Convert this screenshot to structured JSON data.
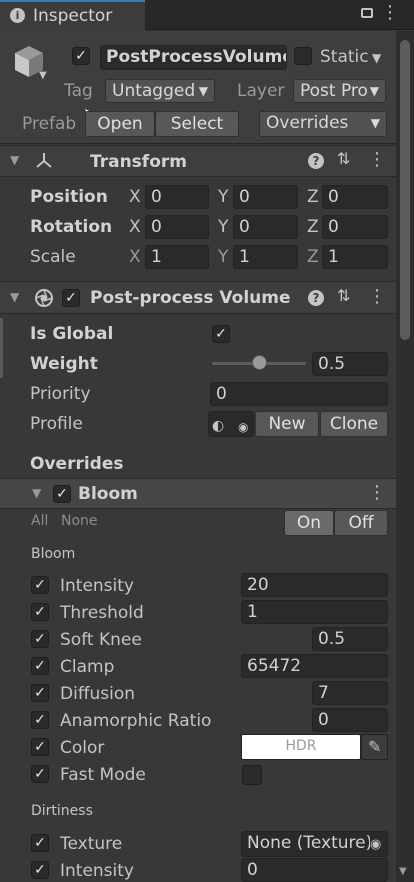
{
  "tab": {
    "title": "Inspector"
  },
  "header": {
    "name": "PostProcessVolume",
    "static_label": "Static",
    "tag_label": "Tag",
    "tag_value": "Untagged",
    "layer_label": "Layer",
    "layer_value": "Post Pro",
    "prefab_label": "Prefab",
    "open_label": "Open",
    "select_label": "Select",
    "overrides_label": "Overrides"
  },
  "transform": {
    "title": "Transform",
    "position": {
      "label": "Position",
      "x": "0",
      "y": "0",
      "z": "0"
    },
    "rotation": {
      "label": "Rotation",
      "x": "0",
      "y": "0",
      "z": "0"
    },
    "scale": {
      "label": "Scale",
      "x": "1",
      "y": "1",
      "z": "1"
    },
    "axis_x": "X",
    "axis_y": "Y",
    "axis_z": "Z"
  },
  "volume": {
    "title": "Post-process Volume",
    "is_global_label": "Is Global",
    "weight_label": "Weight",
    "weight_value": "0.5",
    "weight_fraction": 0.5,
    "priority_label": "Priority",
    "priority_value": "0",
    "profile_label": "Profile",
    "new_label": "New",
    "clone_label": "Clone",
    "overrides_title": "Overrides"
  },
  "bloom": {
    "title": "Bloom",
    "all_label": "All",
    "none_label": "None",
    "on_label": "On",
    "off_label": "Off",
    "section_label": "Bloom",
    "params": [
      {
        "label": "Intensity",
        "value": "20"
      },
      {
        "label": "Threshold",
        "value": "1"
      },
      {
        "label": "Soft Knee",
        "value": "0.5"
      },
      {
        "label": "Clamp",
        "value": "65472"
      },
      {
        "label": "Diffusion",
        "value": "7"
      },
      {
        "label": "Anamorphic Ratio",
        "value": "0"
      },
      {
        "label": "Color",
        "value": "HDR"
      },
      {
        "label": "Fast Mode",
        "value": ""
      }
    ],
    "dirtiness_label": "Dirtiness",
    "dirt": [
      {
        "label": "Texture",
        "value": "None (Texture)"
      },
      {
        "label": "Intensity",
        "value": "0"
      }
    ]
  },
  "colors": {
    "accent_on": "#6a6a6a",
    "color_swatch": "#ffffff"
  }
}
